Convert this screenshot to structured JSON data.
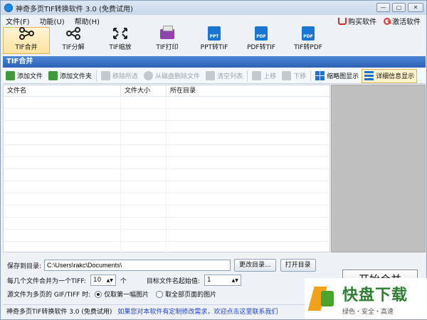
{
  "window": {
    "title": "神奇多页TIF转换软件 3.0 (免费试用)",
    "controls": [
      "—",
      "▢",
      "✕"
    ]
  },
  "menubar": {
    "items": [
      "文件(F)",
      "功能(U)",
      "帮助(H)"
    ],
    "buy_label": "购买软件",
    "activate_label": "激活软件"
  },
  "toolbar": {
    "items": [
      {
        "label": "TIF合并",
        "icon": "merge-icon",
        "active": true
      },
      {
        "label": "TIF分解",
        "icon": "split-icon"
      },
      {
        "label": "TIF缩放",
        "icon": "scale-icon"
      },
      {
        "label": "TIF打印",
        "icon": "printer-icon"
      },
      {
        "label": "PPT转TIF",
        "icon": "ppt-file-icon",
        "badge": "PPT"
      },
      {
        "label": "PDF转TIF",
        "icon": "pdf-file-icon",
        "badge": "PDF"
      },
      {
        "label": "TIF转PDF",
        "icon": "pdf-file-icon",
        "badge": "PDF"
      }
    ]
  },
  "section": {
    "title": "TIF合并"
  },
  "subtoolbar": {
    "add_file": "添加文件",
    "add_folder": "添加文件夹",
    "remove_selected": "移除所选",
    "delete_from_disk": "从磁盘删除文件",
    "clear_list": "清空列表",
    "move_up": "上移",
    "move_down": "下移",
    "thumbnail_view": "缩略图显示",
    "detail_view": "详细信息显示"
  },
  "table": {
    "columns": [
      "文件名",
      "文件大小",
      "所在目录"
    ],
    "rows": []
  },
  "bottom": {
    "save_label": "保存到目录:",
    "save_path": "C:\\Users\\rakc\\Documents\\",
    "change_dir": "更改目录...",
    "open_dir": "打开目录",
    "per_tiff_label": "每几个文件合并为一个TIFF:",
    "per_tiff_value": "10",
    "per_tiff_unit": "个",
    "start_value_label": "目标文件名起始值:",
    "start_value": "1",
    "source_label": "源文件为多页的 GIF/TIFF 时:",
    "option_first": "仅取第一幅图片",
    "option_all": "取全部页面的图片",
    "start_button": "开始合并",
    "spinner_arrows": "▲▼"
  },
  "statusbar": {
    "app": "神奇多页TIF转换软件 3.0 (免费试用)",
    "link": "如果您对本软件有定制修改需求，欢迎点击这里联系我们"
  },
  "watermark": {
    "brand": "快盘下载",
    "tagline": "绿色・安全・高速"
  }
}
